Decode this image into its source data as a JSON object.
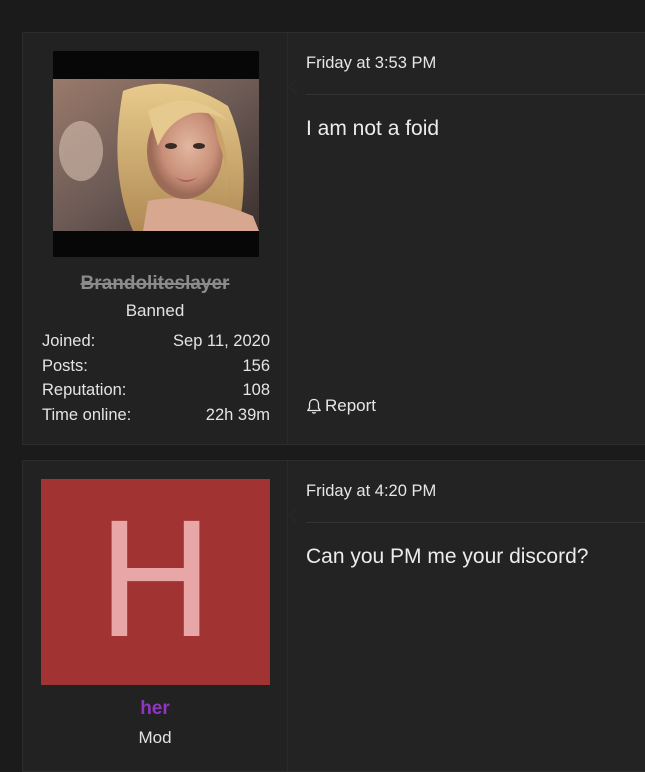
{
  "posts": [
    {
      "user": {
        "name": "Brandoliteslayer",
        "title": "Banned",
        "stats": [
          {
            "label": "Joined:",
            "value": "Sep 11, 2020"
          },
          {
            "label": "Posts:",
            "value": "156"
          },
          {
            "label": "Reputation:",
            "value": "108"
          },
          {
            "label": "Time online:",
            "value": "22h 39m"
          }
        ]
      },
      "date": "Friday at 3:53 PM",
      "message": "I am not a foid",
      "report_label": "Report"
    },
    {
      "user": {
        "avatar_letter": "H",
        "name": "her",
        "title": "Mod"
      },
      "date": "Friday at 4:20 PM",
      "message": "Can you PM me your discord?"
    }
  ],
  "colors": {
    "banned_name": "#8b8b8b",
    "mod_name": "#8f35c0",
    "avatar_letter_bg": "#a23333",
    "avatar_letter_fg": "#e8a6a6"
  }
}
